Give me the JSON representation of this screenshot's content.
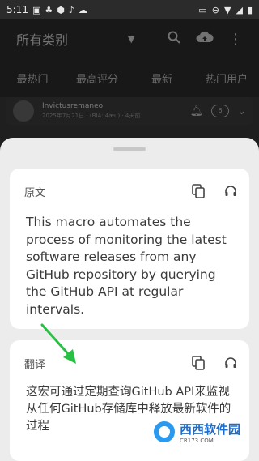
{
  "status_bar": {
    "time": "5:11"
  },
  "header": {
    "category": "所有类别"
  },
  "tabs": [
    "最热门",
    "最高评分",
    "最新",
    "热门用户"
  ],
  "feed": {
    "title": "Invictusremaneo",
    "meta": "2025年7月21日 · (BIA: 4æu) · 4天前",
    "comments": "6"
  },
  "sheet": {
    "original": {
      "label": "原文",
      "text": "This macro automates the process of monitoring the latest software releases from any GitHub repository by querying the GitHub API at regular intervals."
    },
    "translation": {
      "label": "翻译",
      "text": "这宏可通过定期查询GitHub API来监视从任何GitHub存储库中释放最新软件的过程"
    }
  },
  "watermark": {
    "main": "西西软件园",
    "sub": "CR173.COM"
  },
  "colors": {
    "accent_arrow": "#27c043",
    "sheet_bg": "#ececec",
    "card_bg": "#ffffff"
  }
}
